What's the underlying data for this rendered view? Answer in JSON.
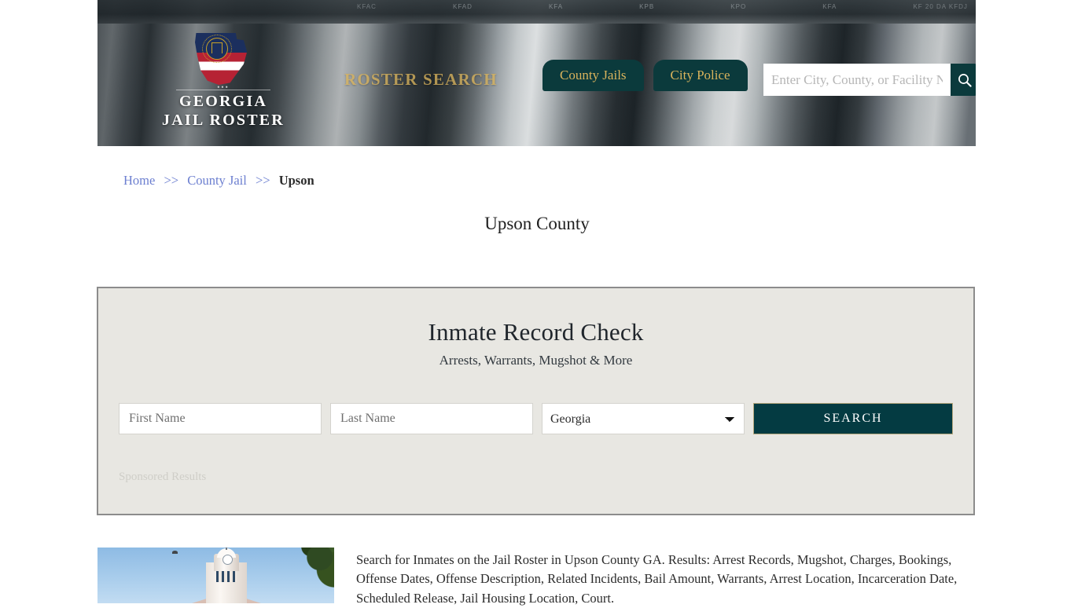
{
  "header": {
    "logo": {
      "line1": "GEORGIA",
      "line2": "JAIL ROSTER",
      "icon": "georgia-state-flag-icon"
    },
    "tagline": "ROSTER SEARCH",
    "nav": [
      {
        "label": "County Jails",
        "name": "nav-county-jails"
      },
      {
        "label": "City Police",
        "name": "nav-city-police"
      }
    ],
    "search": {
      "placeholder": "Enter City, County, or Facility Name",
      "value": "",
      "button_icon": "search-icon"
    },
    "shelf_labels": [
      "KFAC",
      "KFAD",
      "KFA",
      "KPB",
      "KPO",
      "KFA",
      "KF 20 DA KFDJ"
    ]
  },
  "breadcrumb": {
    "home": "Home",
    "sep1": ">>",
    "county_jail": "County Jail",
    "sep2": ">>",
    "current": "Upson"
  },
  "page_title": "Upson County",
  "panel": {
    "title": "Inmate Record Check",
    "subtitle": "Arrests, Warrants, Mugshot & More",
    "first_name_placeholder": "First Name",
    "first_name_value": "",
    "last_name_placeholder": "Last Name",
    "last_name_value": "",
    "state_selected": "Georgia",
    "state_options": [
      "Georgia"
    ],
    "search_button": "SEARCH",
    "sponsored_label": "Sponsored Results"
  },
  "content": {
    "thumbnail_alt": "upson-county-courthouse-photo",
    "description": "Search for Inmates on the Jail Roster in Upson County GA. Results: Arrest Records, Mugshot, Charges, Bookings, Offense Dates, Offense Description, Related Incidents, Bail Amount, Warrants, Arrest Location, Incarceration Date, Scheduled Release, Jail Housing Location, Court."
  },
  "colors": {
    "teal": "#0b3a3c",
    "gold": "#d9b35c",
    "panel_bg": "#e8e7e2",
    "link_blue": "#6c7fd0",
    "button_teal": "#043b42"
  }
}
